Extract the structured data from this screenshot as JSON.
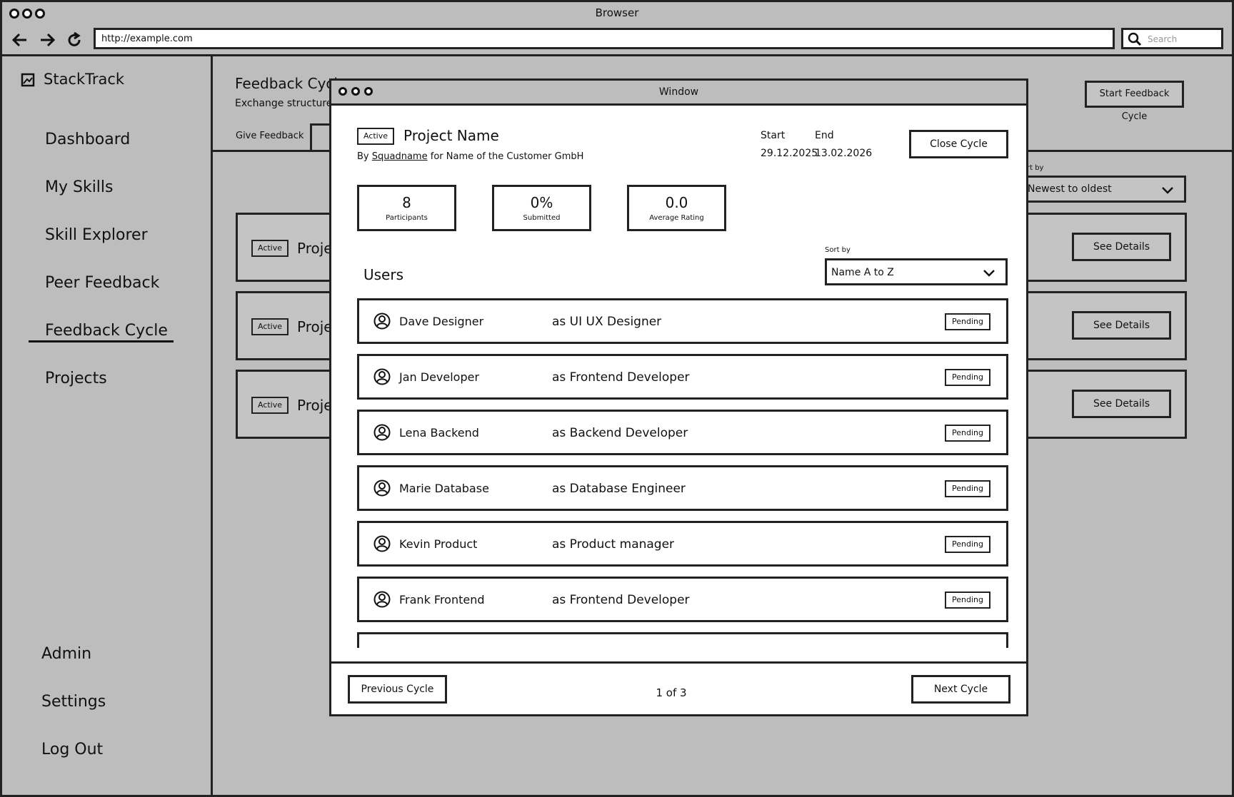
{
  "browser": {
    "title": "Browser",
    "url": "http://example.com",
    "search_placeholder": "Search"
  },
  "sidebar": {
    "brand": "StackTrack",
    "items": [
      "Dashboard",
      "My Skills",
      "Skill Explorer",
      "Peer Feedback",
      "Feedback Cycle",
      "Projects"
    ],
    "bottom": [
      "Admin",
      "Settings",
      "Log Out"
    ],
    "active_item": "Feedback Cycle"
  },
  "page": {
    "title": "Feedback Cycle",
    "subtitle": "Exchange structured s",
    "tab": "Give Feedback",
    "start_button": "Start Feedback Cycle",
    "sort_label": "rt by",
    "sort_value": "Newest to oldest",
    "cards": [
      {
        "badge": "Active",
        "name": "Proje",
        "details": "See Details"
      },
      {
        "badge": "Active",
        "name": "Proje",
        "details": "See Details"
      },
      {
        "badge": "Active",
        "name": "Proje",
        "details": "See Details"
      }
    ]
  },
  "modal": {
    "window_title": "Window",
    "badge": "Active",
    "project_name": "Project Name",
    "by_prefix": "By",
    "squad": "Squadname",
    "for_text": "for Name of the Customer GmbH",
    "start_label": "Start",
    "start_date": "29.12.2025",
    "end_label": "End",
    "end_date": "13.02.2026",
    "close_button": "Close Cycle",
    "stats": [
      {
        "value": "8",
        "label": "Participants"
      },
      {
        "value": "0%",
        "label": "Submitted"
      },
      {
        "value": "0.0",
        "label": "Average Rating"
      }
    ],
    "users_heading": "Users",
    "sort_label": "Sort by",
    "sort_value": "Name A to Z",
    "users": [
      {
        "name": "Dave Designer",
        "role": "as UI UX Designer",
        "status": "Pending"
      },
      {
        "name": "Jan Developer",
        "role": "as Frontend Developer",
        "status": "Pending"
      },
      {
        "name": "Lena Backend",
        "role": "as Backend Developer",
        "status": "Pending"
      },
      {
        "name": "Marie Database",
        "role": "as Database Engineer",
        "status": "Pending"
      },
      {
        "name": "Kevin Product",
        "role": "as Product manager",
        "status": "Pending"
      },
      {
        "name": "Frank Frontend",
        "role": "as Frontend Developer",
        "status": "Pending"
      }
    ],
    "prev_button": "Previous Cycle",
    "pagination": "1 of 3",
    "next_button": "Next Cycle"
  }
}
